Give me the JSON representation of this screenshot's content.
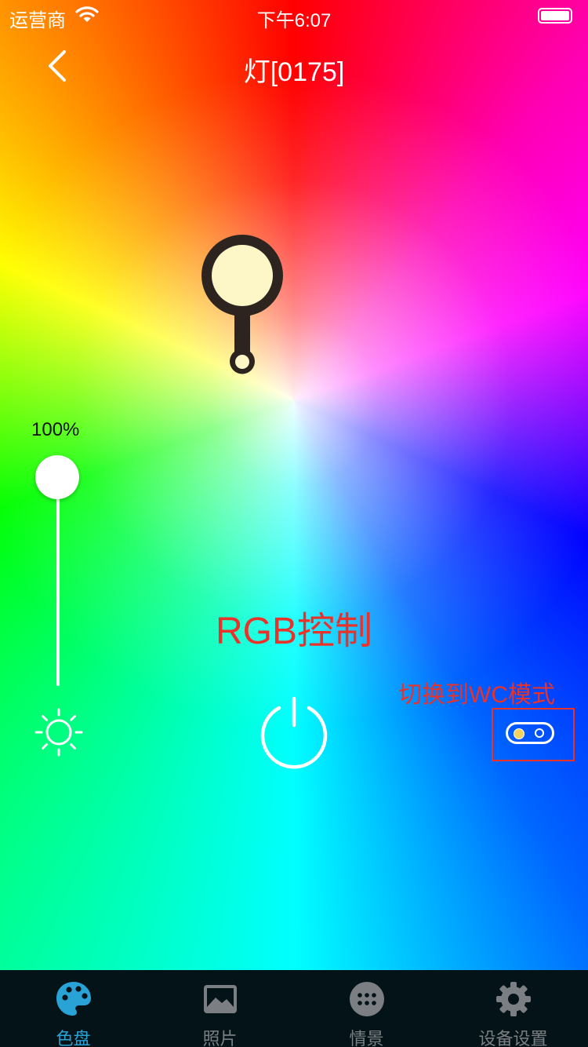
{
  "status_bar": {
    "carrier": "运营商",
    "time": "下午6:07"
  },
  "nav": {
    "title": "灯[0175]"
  },
  "brightness": {
    "label": "100%",
    "value": 1.0
  },
  "annotations": {
    "rgb_control": "RGB控制",
    "switch_wc": "切换到WC模式"
  },
  "tabs": [
    {
      "label": "色盘",
      "icon": "palette-icon",
      "active": true
    },
    {
      "label": "照片",
      "icon": "photo-icon",
      "active": false
    },
    {
      "label": "情景",
      "icon": "scene-icon",
      "active": false
    },
    {
      "label": "设备设置",
      "icon": "gear-icon",
      "active": false
    }
  ],
  "colors": {
    "accent": "#29a3d6",
    "annotation_red": "#e8322a",
    "tabbar_bg": "#041317",
    "bulb_fill": "#fdf7c8",
    "bulb_outline": "#2d2420"
  }
}
